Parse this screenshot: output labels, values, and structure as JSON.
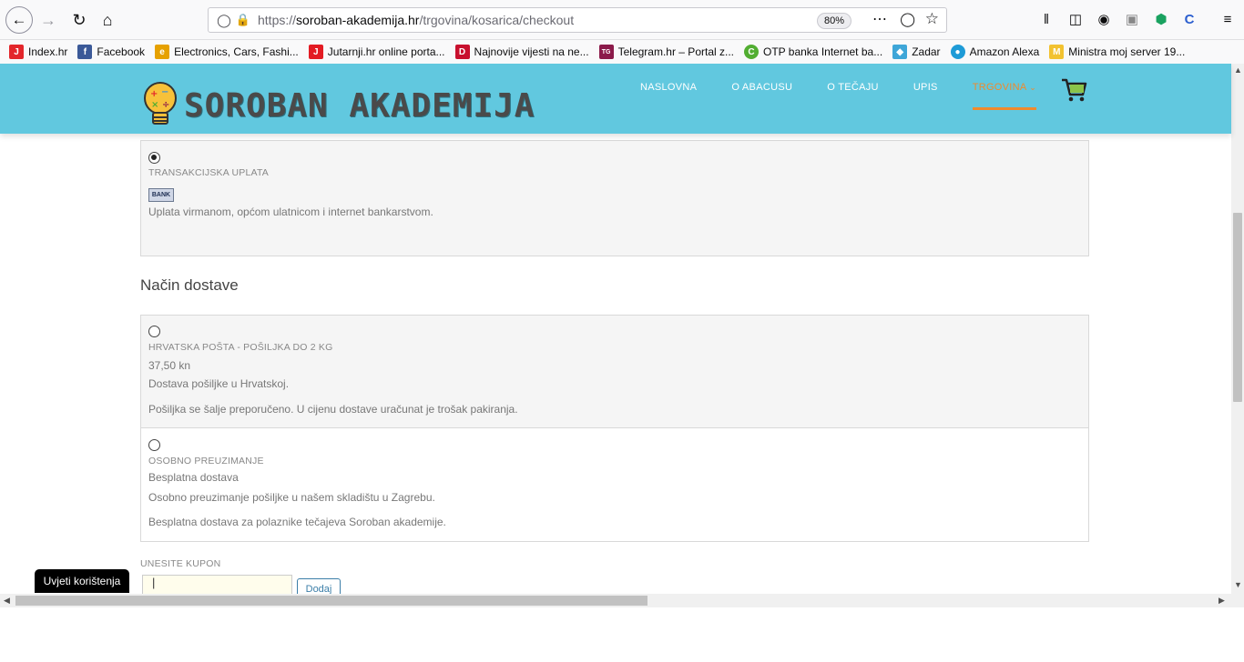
{
  "browser": {
    "url_scheme": "https://",
    "url_host": "soroban-akademija.hr",
    "url_path": "/trgovina/kosarica/checkout",
    "zoom": "80%",
    "bookmarks": [
      {
        "label": "Index.hr",
        "color": "#e3262b",
        "glyph": "J"
      },
      {
        "label": "Facebook",
        "color": "#3b5998",
        "glyph": "f"
      },
      {
        "label": "Electronics, Cars, Fashi...",
        "color": "#e6a100",
        "glyph": "e"
      },
      {
        "label": "Jutarnji.hr online porta...",
        "color": "#e31b23",
        "glyph": "J"
      },
      {
        "label": "Najnovije vijesti na ne...",
        "color": "#c8102e",
        "glyph": "D"
      },
      {
        "label": "Telegram.hr – Portal z...",
        "color": "#8b1a4a",
        "glyph": "TG"
      },
      {
        "label": "OTP banka Internet ba...",
        "color": "#52ae32",
        "glyph": "C"
      },
      {
        "label": "Zadar",
        "color": "#3ea6d8",
        "glyph": "◆"
      },
      {
        "label": "Amazon Alexa",
        "color": "#1e9bd7",
        "glyph": "●"
      },
      {
        "label": "Ministra moj server 19...",
        "color": "#f2c230",
        "glyph": "M"
      }
    ]
  },
  "site": {
    "logo_text": "SOROBAN AKADEMIJA",
    "nav": [
      "NASLOVNA",
      "O ABACUSU",
      "O TEČAJU",
      "UPIS",
      "TRGOVINA"
    ],
    "nav_active_index": 4
  },
  "payment": {
    "title": "TRANSAKCIJSKA UPLATA",
    "badge": "BANK",
    "description": "Uplata virmanom, općom ulatnicom i internet bankarstvom."
  },
  "shipping": {
    "section_title": "Način dostave",
    "options": [
      {
        "title": "HRVATSKA POŠTA - POŠILJKA DO 2 KG",
        "price": "37,50 kn",
        "line1": "Dostava pošiljke u Hrvatskoj.",
        "line2": "Pošiljka se šalje preporučeno. U cijenu dostave uračunat je trošak pakiranja."
      },
      {
        "title": "OSOBNO PREUZIMANJE",
        "price": "Besplatna dostava",
        "line1": "Osobno preuzimanje pošiljke u našem skladištu u Zagrebu.",
        "line2": "Besplatna dostava za polaznike tečajeva Soroban akademije."
      }
    ]
  },
  "coupon": {
    "label": "UNESITE KUPON",
    "value": "|",
    "button": "Dodaj"
  },
  "terms_tab": "Uvjeti korištenja"
}
